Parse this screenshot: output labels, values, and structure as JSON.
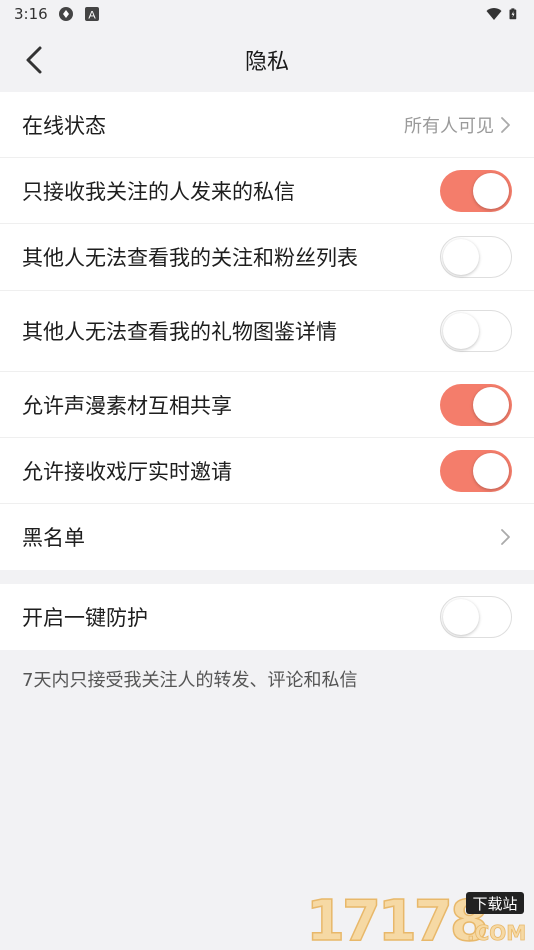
{
  "status_bar": {
    "time": "3:16",
    "icons": [
      "sync-icon",
      "a-icon",
      "wifi-icon",
      "battery-icon"
    ]
  },
  "nav": {
    "title": "隐私",
    "back_icon": "chevron-left-icon"
  },
  "colors": {
    "toggle_on": "#f47d6b",
    "background": "#f2f2f4"
  },
  "settings": {
    "online_status": {
      "label": "在线状态",
      "value": "所有人可见"
    },
    "only_followed_dm": {
      "label": "只接收我关注的人发来的私信",
      "on": true
    },
    "hide_follow_list": {
      "label": "其他人无法查看我的关注和粉丝列表",
      "on": false
    },
    "hide_gift_gallery": {
      "label": "其他人无法查看我的礼物图鉴详情",
      "on": false
    },
    "allow_material_share": {
      "label": "允许声漫素材互相共享",
      "on": true
    },
    "allow_theater_invite": {
      "label": "允许接收戏厅实时邀请",
      "on": true
    },
    "blacklist": {
      "label": "黑名单"
    }
  },
  "protection": {
    "label": "开启一键防护",
    "on": false,
    "note": "7天内只接受我关注人的转发、评论和私信"
  },
  "watermark": {
    "text": "17178",
    "badge": "下载站",
    "suffix": ".COM"
  }
}
